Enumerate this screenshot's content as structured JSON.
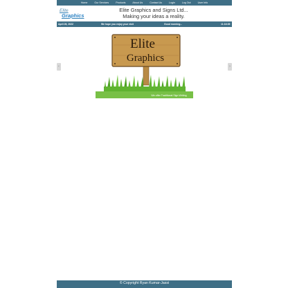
{
  "nav": {
    "items": [
      "Home",
      "Our Services",
      "Products",
      "About Us",
      "Contact Us",
      "Login",
      "Log Out",
      "User Info"
    ]
  },
  "header": {
    "logo_line1": "Elite",
    "logo_line2": "Graphics",
    "company_name": "Elite Graphics and Signs Ltd...",
    "tagline": "Making your ideas a reality."
  },
  "infobar": {
    "date": "April 26, 2022",
    "welcome": "We hope you enjoy your visit",
    "greeting": "Good morning...",
    "time": "11:16:39"
  },
  "slider": {
    "sign_line1": "Elite",
    "sign_line2": "Graphics",
    "caption": "We offer Traditional Sign Writing",
    "prev_glyph": "‹",
    "next_glyph": "›"
  },
  "footer": {
    "copyright": "© Copyright Ryan Kumar-Jassi"
  },
  "colors": {
    "nav_bg": "#3f6f86",
    "grass": "#5fb330",
    "sign_wood": "#c8994f",
    "caption_bg": "#78c046"
  }
}
